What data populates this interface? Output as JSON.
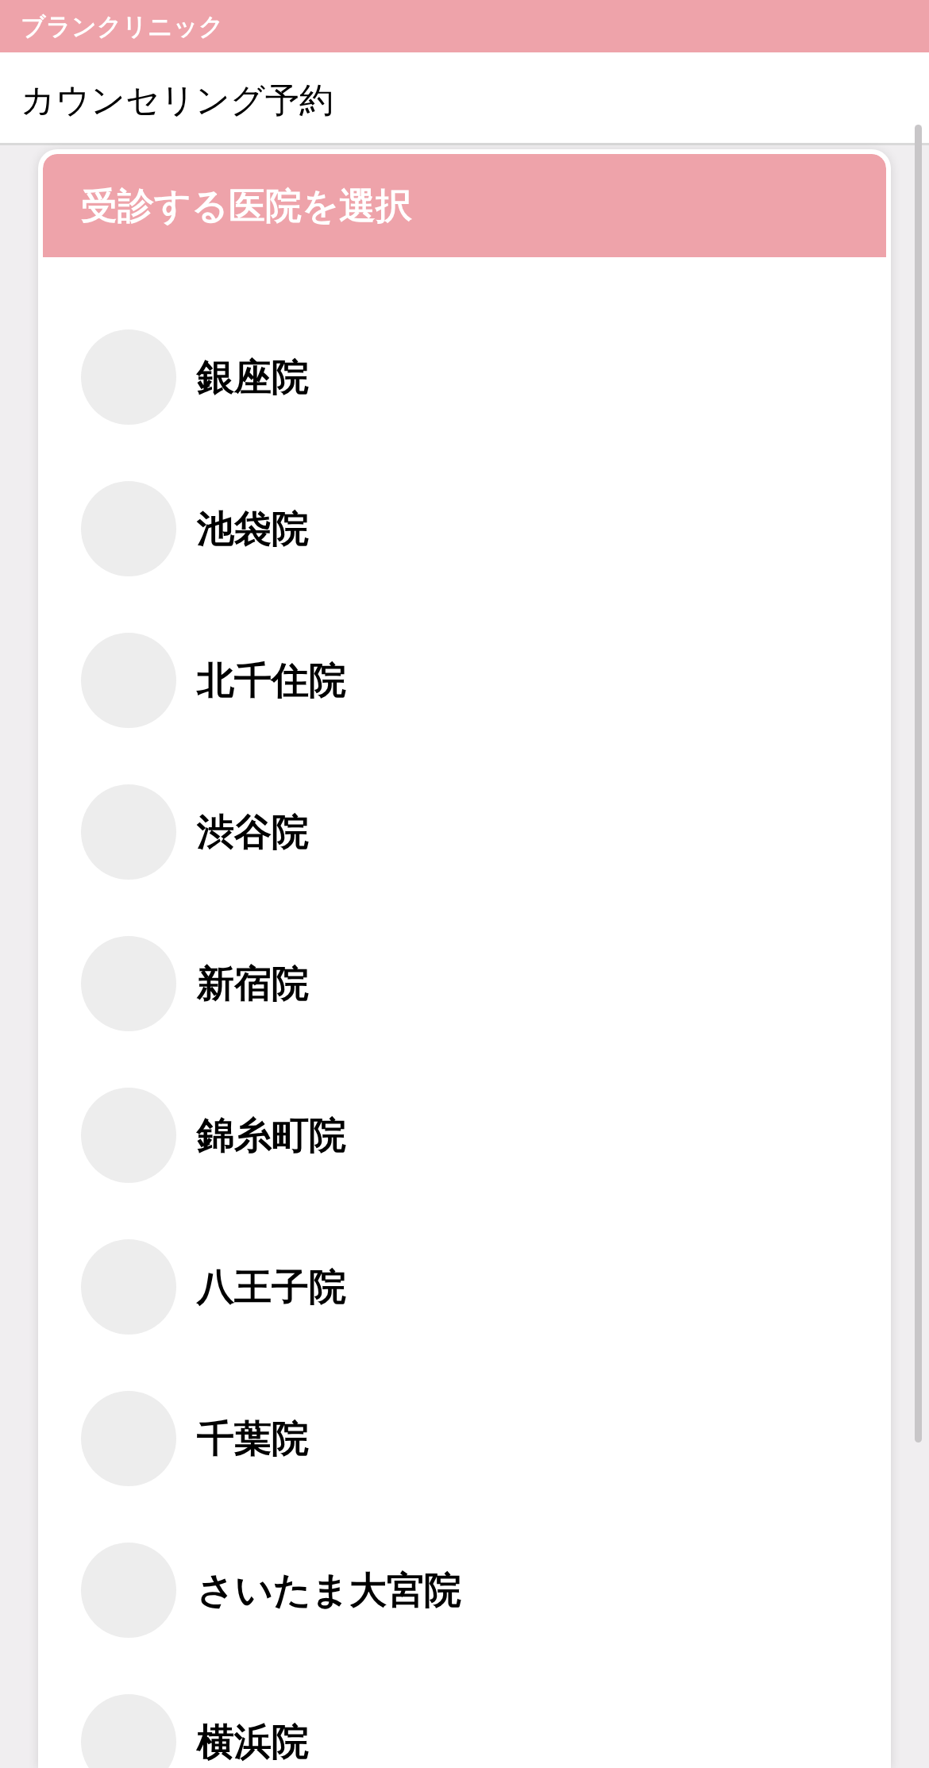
{
  "app_bar": {
    "title": "ブランクリニック"
  },
  "header": {
    "title": "カウンセリング予約"
  },
  "clinic_picker": {
    "title": "受診する医院を選択",
    "clinics": [
      {
        "name": "銀座院",
        "selected": false
      },
      {
        "name": "池袋院",
        "selected": false
      },
      {
        "name": "北千住院",
        "selected": false
      },
      {
        "name": "渋谷院",
        "selected": false
      },
      {
        "name": "新宿院",
        "selected": false
      },
      {
        "name": "錦糸町院",
        "selected": false
      },
      {
        "name": "八王子院",
        "selected": false
      },
      {
        "name": "千葉院",
        "selected": false
      },
      {
        "name": "さいたま大宮院",
        "selected": false
      },
      {
        "name": "横浜院",
        "selected": false
      }
    ]
  }
}
